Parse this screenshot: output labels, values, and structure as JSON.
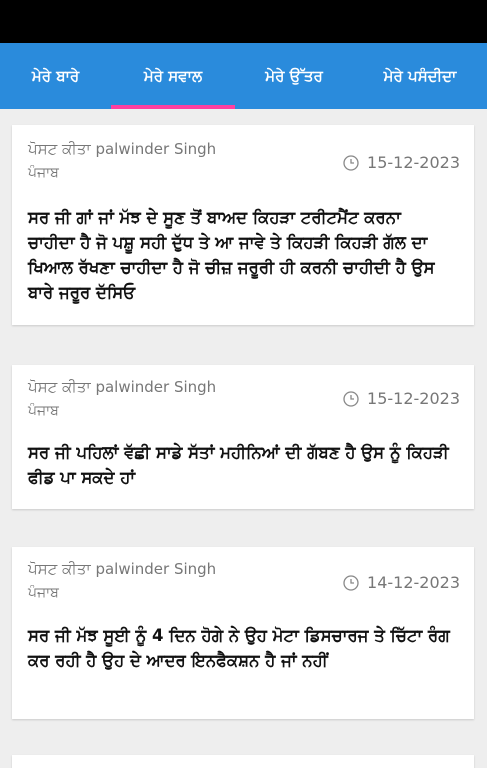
{
  "tabs": [
    {
      "label": "ਮੇਰੇ ਬਾਰੇ",
      "active": false
    },
    {
      "label": "ਮੇਰੇ ਸਵਾਲ",
      "active": true
    },
    {
      "label": "ਮੇਰੇ ਉੱਤਰ",
      "active": false
    },
    {
      "label": "ਮੇਰੇ ਪਸੰਦੀਦਾ",
      "active": false
    }
  ],
  "posts": [
    {
      "author_line": "ਪੋਸਟ ਕੀਤਾ palwinder Singh",
      "location": "ਪੰਜਾਬ",
      "date": "15-12-2023",
      "question": "ਸਰ ਜੀ ਗਾਂ ਜਾਂ ਮੱਝ ਦੇ ਸੂਣ ਤੋਂ ਬਾਅਦ ਕਿਹੜਾ ਟਰੀਟਮੈਂਟ ਕਰਨਾ ਚਾਹੀਦਾ ਹੈ ਜੋ ਪਸ਼ੂ ਸਹੀ ਦੁੱਧ ਤੇ ਆ ਜਾਵੇ ਤੇ ਕਿਹੜੀ ਕਿਹੜੀ ਗੱਲ ਦਾ ਖਿਆਲ ਰੱਖਣਾ ਚਾਹੀਦਾ ਹੈ ਜੋ ਚੀਜ਼ ਜਰੂਰੀ ਹੀ ਕਰਨੀ ਚਾਹੀਦੀ ਹੈ ਉਸ ਬਾਰੇ ਜਰੂਰ ਦੱਸਿਓ"
    },
    {
      "author_line": "ਪੋਸਟ ਕੀਤਾ palwinder Singh",
      "location": "ਪੰਜਾਬ",
      "date": "15-12-2023",
      "question": "ਸਰ ਜੀ ਪਹਿਲਾਂ ਵੱਛੀ ਸਾਡੇ ਸੱਤਾਂ ਮਹੀਨਿਆਂ ਦੀ ਗੱਬਣ ਹੈ ਉਸ ਨੂੰ ਕਿਹੜੀ ਫੀਡ ਪਾ ਸਕਦੇ ਹਾਂ"
    },
    {
      "author_line": "ਪੋਸਟ ਕੀਤਾ palwinder Singh",
      "location": "ਪੰਜਾਬ",
      "date": "14-12-2023",
      "question": "ਸਰ ਜੀ ਮੱਝ ਸੂਈ ਨੂੰ 4 ਦਿਨ ਹੋਗੇ ਨੇ ਉਹ ਮੋਟਾ ਡਿਸਚਾਰਜ ਤੇ ਚਿੱਟਾ ਰੰਗ  ਕਰ ਰਹੀ ਹੈ  ਉਹ ਦੇ ਆਦਰ ਇਨਫੈਕਸ਼ਨ ਹੈ ਜਾਂ ਨਹੀਂ"
    }
  ],
  "colors": {
    "app_bar": "#2a8bdc",
    "tab_indicator": "#ff3fa0",
    "status_bar": "#000000",
    "background": "#eeeeee"
  },
  "icons": {
    "date": "clock-icon"
  }
}
